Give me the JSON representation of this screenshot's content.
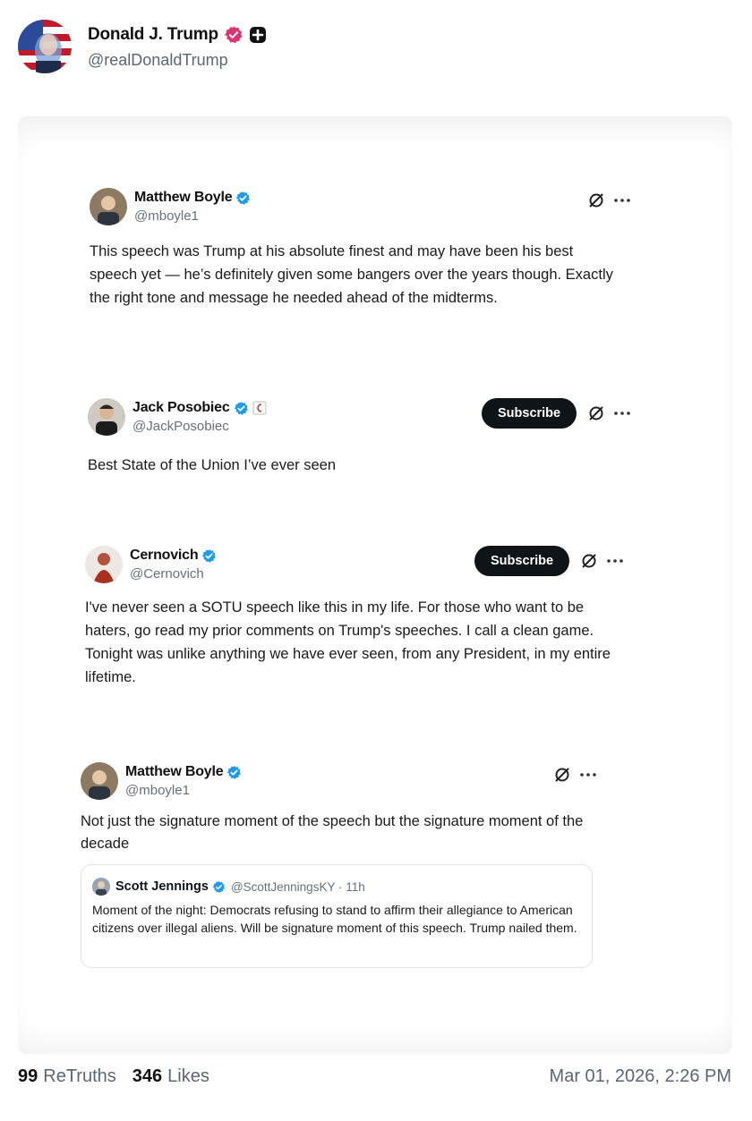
{
  "post": {
    "author_name": "Donald J. Trump",
    "author_handle": "@realDonaldTrump",
    "colors": {
      "verified_badge": "#e0336f",
      "subscribe_button": "#0f1419",
      "twitter_check": "#1d9bf0"
    }
  },
  "embedded_tweets": [
    {
      "name": "Matthew Boyle",
      "handle": "@mboyle1",
      "text": "This speech was Trump at his absolute finest and may have been his best speech yet — he’s definitely given some bangers over the years though. Exactly the right tone and message he needed ahead of the midterms."
    },
    {
      "name": "Jack Posobiec",
      "handle": "@JackPosobiec",
      "subscribe_label": "Subscribe",
      "text": "Best State of the Union I’ve ever seen"
    },
    {
      "name": "Cernovich",
      "handle": "@Cernovich",
      "subscribe_label": "Subscribe",
      "text": "I've never seen a SOTU speech like this in my life. For those who want to be haters, go read my prior comments on Trump's speeches. I call a clean game. Tonight was unlike anything we have ever seen, from any President, in my entire lifetime."
    },
    {
      "name": "Matthew Boyle",
      "handle": "@mboyle1",
      "text": "Not just the signature moment of the speech but the signature moment of the decade",
      "quote": {
        "name": "Scott Jennings",
        "handle": "@ScottJenningsKY · 11h",
        "text": "Moment of the night: Democrats refusing to stand to affirm their allegiance to American citizens over illegal aliens. Will be signature moment of this speech. Trump nailed them."
      }
    }
  ],
  "footer": {
    "retruths_count": "99",
    "retruths_label": "ReTruths",
    "likes_count": "346",
    "likes_label": "Likes",
    "timestamp": "Mar 01, 2026, 2:26 PM"
  }
}
